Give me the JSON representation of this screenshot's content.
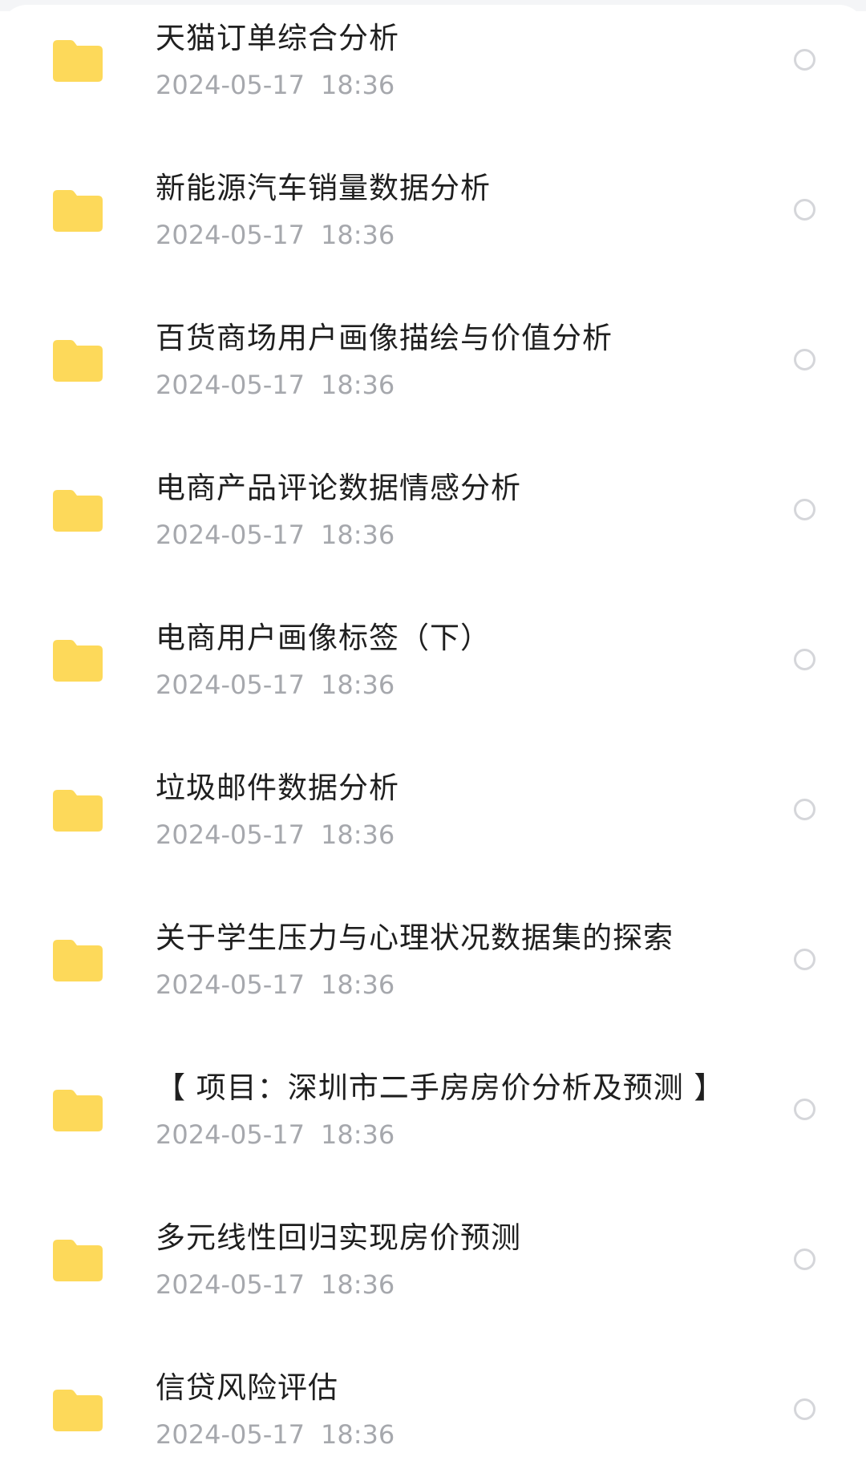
{
  "files": [
    {
      "title": "天猫订单综合分析",
      "date": "2024-05-17",
      "time": "18:36"
    },
    {
      "title": "新能源汽车销量数据分析",
      "date": "2024-05-17",
      "time": "18:36"
    },
    {
      "title": "百货商场用户画像描绘与价值分析",
      "date": "2024-05-17",
      "time": "18:36"
    },
    {
      "title": "电商产品评论数据情感分析",
      "date": "2024-05-17",
      "time": "18:36"
    },
    {
      "title": "电商用户画像标签（下）",
      "date": "2024-05-17",
      "time": "18:36"
    },
    {
      "title": "垃圾邮件数据分析",
      "date": "2024-05-17",
      "time": "18:36"
    },
    {
      "title": "关于学生压力与心理状况数据集的探索",
      "date": "2024-05-17",
      "time": "18:36"
    },
    {
      "title": "【 项目：深圳市二手房房价分析及预测 】",
      "date": "2024-05-17",
      "time": "18:36"
    },
    {
      "title": "多元线性回归实现房价预测",
      "date": "2024-05-17",
      "time": "18:36"
    },
    {
      "title": "信贷风险评估",
      "date": "2024-05-17",
      "time": "18:36"
    }
  ],
  "icons": {
    "folder": "folder-icon",
    "select": "radio-unchecked-icon"
  },
  "colors": {
    "folder": "#fdd95a",
    "title": "#1f1f1f",
    "meta": "#a6a8ad",
    "radio_border": "#d5d6da"
  }
}
